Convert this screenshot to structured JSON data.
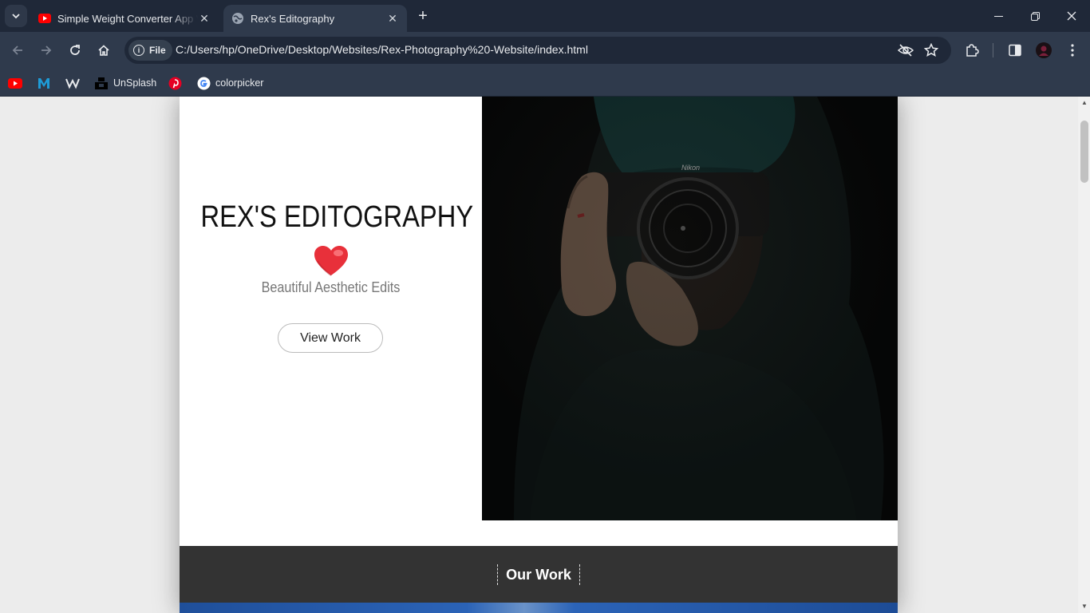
{
  "browser": {
    "tabs": [
      {
        "title": "Simple Weight Converter App W",
        "favicon": "youtube-icon",
        "active": false
      },
      {
        "title": "Rex's Editography",
        "favicon": "globe-icon",
        "active": true
      }
    ],
    "address": {
      "scheme_label": "File",
      "url": "C:/Users/hp/OneDrive/Desktop/Websites/Rex-Photography%20-Website/index.html"
    },
    "bookmarks": [
      {
        "label": "",
        "icon": "youtube-icon"
      },
      {
        "label": "",
        "icon": "m-icon"
      },
      {
        "label": "",
        "icon": "w-logo-icon"
      },
      {
        "label": "UnSplash",
        "icon": "unsplash-icon"
      },
      {
        "label": "",
        "icon": "pinterest-icon"
      },
      {
        "label": "colorpicker",
        "icon": "google-icon"
      }
    ]
  },
  "page": {
    "hero": {
      "title": "REX'S EDITOGRAPHY",
      "subtitle": "Beautiful Aesthetic Edits",
      "button_label": "View Work"
    },
    "work_section": {
      "title": "Our Work"
    }
  },
  "colors": {
    "browser_frame": "#1f2838",
    "toolbar": "#2f3a4c",
    "page_bg": "#ececec",
    "band": "#333333",
    "heart": "#e8303a"
  }
}
